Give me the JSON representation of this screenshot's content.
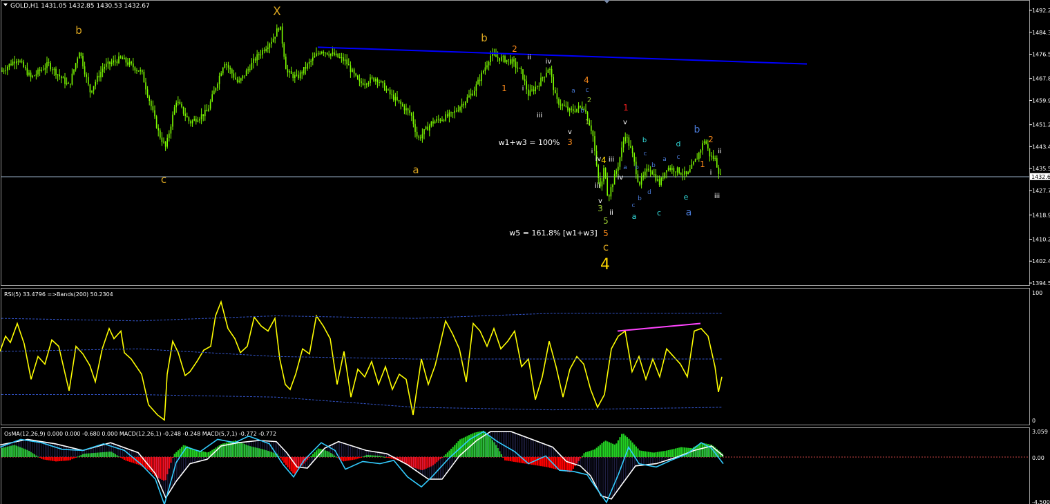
{
  "window": {
    "symbol_header": "GOLD,H1  1431.05 1432.85 1430.53 1432.67"
  },
  "colors": {
    "background": "#000000",
    "candle": "#7CFC00",
    "trendline": "#0000FF",
    "rsi": "#FFFF00",
    "bands": "#3355CC",
    "divergence": "#FF44FF",
    "macd_line": "#FFFFFF",
    "signal_line": "#33CCFF",
    "hist_up": "#22CC22",
    "hist_down": "#FF0000",
    "axis_text": "#FFFFFF",
    "orange_label": "#DAA520",
    "wave_orange": "#FF8C1A",
    "wave_blue": "#4A7BD8",
    "wave_cyan": "#33DDDD",
    "wave_red": "#FF2020",
    "wave_white": "#FFFFFF",
    "wave_yellow": "#FFD700",
    "wave_green": "#9ACD32"
  },
  "price_axis": {
    "ticks": [
      "1492.20",
      "1484.35",
      "1476.50",
      "1467.80",
      "1459.95",
      "1451.25",
      "1443.40",
      "1435.55",
      "1427.70",
      "1418.95",
      "1410.25",
      "1402.40",
      "1394.55"
    ],
    "current": "1432.67"
  },
  "rsi_panel": {
    "header": "RSI(5) 33.4796  =>Bands(200) 50.2304",
    "ticks": [
      "100",
      "0"
    ]
  },
  "macd_panel": {
    "header": "OsMA(12,26,9) 0.000 0.000 -0.680 0.000  MACD(12,26,1) -0.248 -0.248  MACD(5,7,1) -0.772 -0.772",
    "ticks": [
      "3.059",
      "0.00",
      "-4.500"
    ]
  },
  "annotations": {
    "x_top": "X",
    "b1": "b",
    "c1": "c",
    "a1": "a",
    "b2": "b",
    "two": "2",
    "ii": "ii",
    "iv": "iv",
    "one": "1",
    "i": "i",
    "iii": "iii",
    "four_o": "4",
    "a_s": "a",
    "c_s": "c",
    "two_s": "2",
    "b_s": "b",
    "one_s": "1",
    "v": "v",
    "three_o": "3",
    "w1w3": "w1+w3 = 100%",
    "w5": "w5 = 161.8% [w1+w3]",
    "red1": "1",
    "v2": "v",
    "i2": "i",
    "iv2": "iv",
    "four_y": "4",
    "iii2": "iii",
    "iii3": "iii",
    "v3": "v",
    "three_g": "3",
    "ii2": "ii",
    "five_g": "5",
    "five_o": "5",
    "c_bottom": "c",
    "four_big": "4",
    "iv3": "iv",
    "b_c1": "b",
    "c_c1": "c",
    "a_c": "a",
    "b_c2": "b",
    "a_c2": "a",
    "c_c2": "c",
    "b_c3": "b",
    "b_c4": "b",
    "d_c": "d",
    "c_c3": "c",
    "a_cyan": "a",
    "c_cyan": "c",
    "d_cyan": "d",
    "e_cyan": "e",
    "a_bottom": "a",
    "b_big": "b",
    "two_r": "2",
    "ii3": "ii",
    "one_r": "1",
    "i3": "i",
    "iii4": "iii"
  },
  "chart_data": {
    "type": "candlestick",
    "symbol": "GOLD",
    "timeframe": "H1",
    "ohlc_last": {
      "open": 1431.05,
      "high": 1432.85,
      "low": 1430.53,
      "close": 1432.67
    },
    "price_range": [
      1392.0,
      1495.0
    ],
    "segments": [
      [
        0,
        1470
      ],
      [
        25,
        1475
      ],
      [
        45,
        1468
      ],
      [
        70,
        1473
      ],
      [
        100,
        1465
      ],
      [
        115,
        1478
      ],
      [
        130,
        1463
      ],
      [
        150,
        1472
      ],
      [
        175,
        1475
      ],
      [
        205,
        1470
      ],
      [
        230,
        1448
      ],
      [
        240,
        1443
      ],
      [
        255,
        1460
      ],
      [
        275,
        1452
      ],
      [
        300,
        1456
      ],
      [
        325,
        1474
      ],
      [
        345,
        1466
      ],
      [
        370,
        1475
      ],
      [
        395,
        1482
      ],
      [
        405,
        1487
      ],
      [
        415,
        1470
      ],
      [
        430,
        1468
      ],
      [
        450,
        1474
      ],
      [
        465,
        1478
      ],
      [
        485,
        1476
      ],
      [
        500,
        1474
      ],
      [
        520,
        1466
      ],
      [
        545,
        1468
      ],
      [
        565,
        1462
      ],
      [
        595,
        1455
      ],
      [
        605,
        1446
      ],
      [
        625,
        1452
      ],
      [
        655,
        1455
      ],
      [
        685,
        1463
      ],
      [
        695,
        1468
      ],
      [
        710,
        1476
      ],
      [
        740,
        1474
      ],
      [
        755,
        1470
      ],
      [
        765,
        1462
      ],
      [
        780,
        1466
      ],
      [
        795,
        1472
      ],
      [
        805,
        1460
      ],
      [
        825,
        1456
      ],
      [
        845,
        1458
      ],
      [
        858,
        1448
      ],
      [
        865,
        1433
      ],
      [
        870,
        1428
      ],
      [
        875,
        1437
      ],
      [
        880,
        1425
      ],
      [
        895,
        1437
      ],
      [
        905,
        1448
      ],
      [
        915,
        1441
      ],
      [
        925,
        1430
      ],
      [
        940,
        1436
      ],
      [
        955,
        1430
      ],
      [
        965,
        1436
      ],
      [
        980,
        1435
      ],
      [
        995,
        1433
      ],
      [
        1010,
        1440
      ],
      [
        1020,
        1446
      ],
      [
        1028,
        1440
      ],
      [
        1035,
        1439
      ],
      [
        1045,
        1431
      ]
    ],
    "trendline": {
      "from": [
        460,
        1479
      ],
      "to": [
        1168,
        1473
      ]
    },
    "current_price": 1432.67,
    "rsi": {
      "period": 5,
      "value": 33.4796,
      "bands_period": 200,
      "bands_value": 50.2304,
      "points": [
        [
          0,
          56
        ],
        [
          8,
          68
        ],
        [
          15,
          63
        ],
        [
          25,
          78
        ],
        [
          35,
          62
        ],
        [
          45,
          34
        ],
        [
          55,
          52
        ],
        [
          65,
          46
        ],
        [
          75,
          65
        ],
        [
          85,
          60
        ],
        [
          100,
          25
        ],
        [
          110,
          60
        ],
        [
          120,
          54
        ],
        [
          130,
          45
        ],
        [
          138,
          32
        ],
        [
          148,
          58
        ],
        [
          158,
          74
        ],
        [
          165,
          66
        ],
        [
          175,
          72
        ],
        [
          180,
          55
        ],
        [
          190,
          50
        ],
        [
          205,
          38
        ],
        [
          215,
          14
        ],
        [
          228,
          6
        ],
        [
          238,
          2
        ],
        [
          242,
          38
        ],
        [
          250,
          64
        ],
        [
          258,
          55
        ],
        [
          268,
          37
        ],
        [
          275,
          40
        ],
        [
          285,
          48
        ],
        [
          295,
          57
        ],
        [
          305,
          60
        ],
        [
          312,
          84
        ],
        [
          320,
          95
        ],
        [
          330,
          74
        ],
        [
          340,
          66
        ],
        [
          348,
          55
        ],
        [
          358,
          60
        ],
        [
          368,
          83
        ],
        [
          378,
          76
        ],
        [
          388,
          72
        ],
        [
          398,
          82
        ],
        [
          405,
          50
        ],
        [
          413,
          30
        ],
        [
          420,
          26
        ],
        [
          428,
          38
        ],
        [
          438,
          58
        ],
        [
          448,
          54
        ],
        [
          458,
          84
        ],
        [
          468,
          76
        ],
        [
          478,
          66
        ],
        [
          488,
          30
        ],
        [
          498,
          56
        ],
        [
          508,
          20
        ],
        [
          518,
          42
        ],
        [
          528,
          36
        ],
        [
          538,
          48
        ],
        [
          548,
          30
        ],
        [
          558,
          44
        ],
        [
          568,
          26
        ],
        [
          578,
          38
        ],
        [
          588,
          34
        ],
        [
          598,
          6
        ],
        [
          610,
          50
        ],
        [
          620,
          30
        ],
        [
          630,
          45
        ],
        [
          645,
          80
        ],
        [
          655,
          70
        ],
        [
          665,
          58
        ],
        [
          675,
          32
        ],
        [
          685,
          78
        ],
        [
          695,
          72
        ],
        [
          705,
          60
        ],
        [
          715,
          74
        ],
        [
          725,
          58
        ],
        [
          735,
          64
        ],
        [
          745,
          72
        ],
        [
          755,
          44
        ],
        [
          765,
          50
        ],
        [
          775,
          18
        ],
        [
          785,
          36
        ],
        [
          795,
          64
        ],
        [
          805,
          44
        ],
        [
          815,
          20
        ],
        [
          825,
          42
        ],
        [
          835,
          52
        ],
        [
          845,
          46
        ],
        [
          855,
          26
        ],
        [
          865,
          12
        ],
        [
          875,
          22
        ],
        [
          885,
          58
        ],
        [
          895,
          68
        ],
        [
          905,
          72
        ],
        [
          915,
          40
        ],
        [
          925,
          52
        ],
        [
          935,
          34
        ],
        [
          945,
          50
        ],
        [
          955,
          36
        ],
        [
          965,
          58
        ],
        [
          975,
          52
        ],
        [
          985,
          46
        ],
        [
          995,
          36
        ],
        [
          1005,
          72
        ],
        [
          1015,
          74
        ],
        [
          1025,
          68
        ],
        [
          1035,
          44
        ],
        [
          1040,
          24
        ],
        [
          1045,
          36
        ]
      ],
      "divergence_line": {
        "from": [
          894,
          72
        ],
        "to": [
          1014,
          78
        ]
      }
    },
    "macd": {
      "osma": [
        12,
        26,
        9
      ],
      "macd_fast": [
        12,
        26,
        1
      ],
      "macd_slow": [
        5,
        7,
        1
      ],
      "last": -0.772,
      "range": [
        -4.5,
        3.06
      ],
      "white": [
        [
          0,
          1.1
        ],
        [
          40,
          1.6
        ],
        [
          80,
          1.2
        ],
        [
          120,
          0.6
        ],
        [
          160,
          1.3
        ],
        [
          200,
          0.4
        ],
        [
          225,
          -1.5
        ],
        [
          240,
          -3.7
        ],
        [
          255,
          -2.2
        ],
        [
          275,
          -0.6
        ],
        [
          300,
          -0.2
        ],
        [
          320,
          1.0
        ],
        [
          345,
          1.3
        ],
        [
          375,
          1.5
        ],
        [
          400,
          1.4
        ],
        [
          415,
          0.4
        ],
        [
          430,
          -0.9
        ],
        [
          445,
          -1.0
        ],
        [
          470,
          0.8
        ],
        [
          490,
          1.4
        ],
        [
          510,
          1.0
        ],
        [
          530,
          0.6
        ],
        [
          560,
          0.3
        ],
        [
          590,
          -0.7
        ],
        [
          620,
          -2.0
        ],
        [
          640,
          -2.0
        ],
        [
          665,
          0.1
        ],
        [
          690,
          1.5
        ],
        [
          710,
          2.3
        ],
        [
          740,
          2.3
        ],
        [
          770,
          1.6
        ],
        [
          800,
          0.9
        ],
        [
          820,
          -0.4
        ],
        [
          840,
          -0.8
        ],
        [
          855,
          -1.7
        ],
        [
          870,
          -3.5
        ],
        [
          885,
          -3.8
        ],
        [
          900,
          -2.5
        ],
        [
          920,
          -0.8
        ],
        [
          950,
          -0.6
        ],
        [
          980,
          0.0
        ],
        [
          1005,
          0.6
        ],
        [
          1030,
          1.0
        ],
        [
          1047,
          0.1
        ]
      ],
      "cyan": [
        [
          0,
          0.9
        ],
        [
          30,
          1.6
        ],
        [
          60,
          1.3
        ],
        [
          90,
          0.7
        ],
        [
          120,
          0.6
        ],
        [
          150,
          1.2
        ],
        [
          180,
          0.6
        ],
        [
          205,
          -0.7
        ],
        [
          225,
          -2.0
        ],
        [
          238,
          -4.3
        ],
        [
          255,
          -0.5
        ],
        [
          270,
          0.9
        ],
        [
          290,
          0.5
        ],
        [
          315,
          1.6
        ],
        [
          340,
          1.3
        ],
        [
          360,
          1.9
        ],
        [
          390,
          1.2
        ],
        [
          410,
          -0.7
        ],
        [
          425,
          -1.8
        ],
        [
          440,
          -0.3
        ],
        [
          465,
          1.3
        ],
        [
          485,
          0.6
        ],
        [
          500,
          -1.1
        ],
        [
          525,
          -0.4
        ],
        [
          550,
          -0.6
        ],
        [
          570,
          -0.3
        ],
        [
          590,
          -1.8
        ],
        [
          610,
          -2.7
        ],
        [
          625,
          -1.8
        ],
        [
          650,
          -0.1
        ],
        [
          680,
          1.6
        ],
        [
          700,
          2.3
        ],
        [
          720,
          1.4
        ],
        [
          745,
          0.5
        ],
        [
          765,
          -0.6
        ],
        [
          790,
          0.1
        ],
        [
          810,
          -1.2
        ],
        [
          830,
          -1.3
        ],
        [
          850,
          -1.6
        ],
        [
          862,
          -2.7
        ],
        [
          878,
          -4.1
        ],
        [
          895,
          -1.6
        ],
        [
          910,
          0.9
        ],
        [
          925,
          -0.6
        ],
        [
          950,
          -0.9
        ],
        [
          975,
          -0.2
        ],
        [
          995,
          0.3
        ],
        [
          1015,
          1.3
        ],
        [
          1030,
          0.8
        ],
        [
          1047,
          -0.6
        ]
      ],
      "histogram": [
        [
          0,
          0.8
        ],
        [
          20,
          1.1
        ],
        [
          40,
          0.6
        ],
        [
          60,
          -0.2
        ],
        [
          80,
          -0.4
        ],
        [
          100,
          -0.3
        ],
        [
          120,
          0.3
        ],
        [
          140,
          0.4
        ],
        [
          160,
          0.5
        ],
        [
          180,
          -0.3
        ],
        [
          200,
          -0.7
        ],
        [
          215,
          -1.2
        ],
        [
          225,
          -1.8
        ],
        [
          238,
          -2.2
        ],
        [
          250,
          0.2
        ],
        [
          265,
          1.1
        ],
        [
          280,
          0.7
        ],
        [
          300,
          0.4
        ],
        [
          320,
          1.2
        ],
        [
          340,
          1.5
        ],
        [
          360,
          1.0
        ],
        [
          380,
          0.7
        ],
        [
          400,
          0.3
        ],
        [
          415,
          -0.9
        ],
        [
          425,
          -1.6
        ],
        [
          440,
          -0.5
        ],
        [
          460,
          0.8
        ],
        [
          475,
          0.5
        ],
        [
          495,
          -0.4
        ],
        [
          515,
          -0.2
        ],
        [
          530,
          0.2
        ],
        [
          550,
          0.1
        ],
        [
          575,
          -0.3
        ],
        [
          595,
          -0.9
        ],
        [
          610,
          -1.2
        ],
        [
          625,
          -0.8
        ],
        [
          645,
          0.3
        ],
        [
          665,
          1.6
        ],
        [
          685,
          2.2
        ],
        [
          700,
          2.4
        ],
        [
          715,
          1.3
        ],
        [
          730,
          -0.3
        ],
        [
          750,
          -0.5
        ],
        [
          770,
          -0.7
        ],
        [
          790,
          -0.9
        ],
        [
          810,
          -1.2
        ],
        [
          825,
          -1.4
        ],
        [
          845,
          0.4
        ],
        [
          860,
          0.7
        ],
        [
          875,
          1.5
        ],
        [
          890,
          1.1
        ],
        [
          900,
          2.2
        ],
        [
          912,
          1.5
        ],
        [
          925,
          0.6
        ],
        [
          945,
          0.4
        ],
        [
          965,
          0.6
        ],
        [
          985,
          0.9
        ],
        [
          1000,
          0.8
        ],
        [
          1015,
          1.3
        ],
        [
          1030,
          1.1
        ],
        [
          1045,
          0.3
        ]
      ]
    }
  }
}
